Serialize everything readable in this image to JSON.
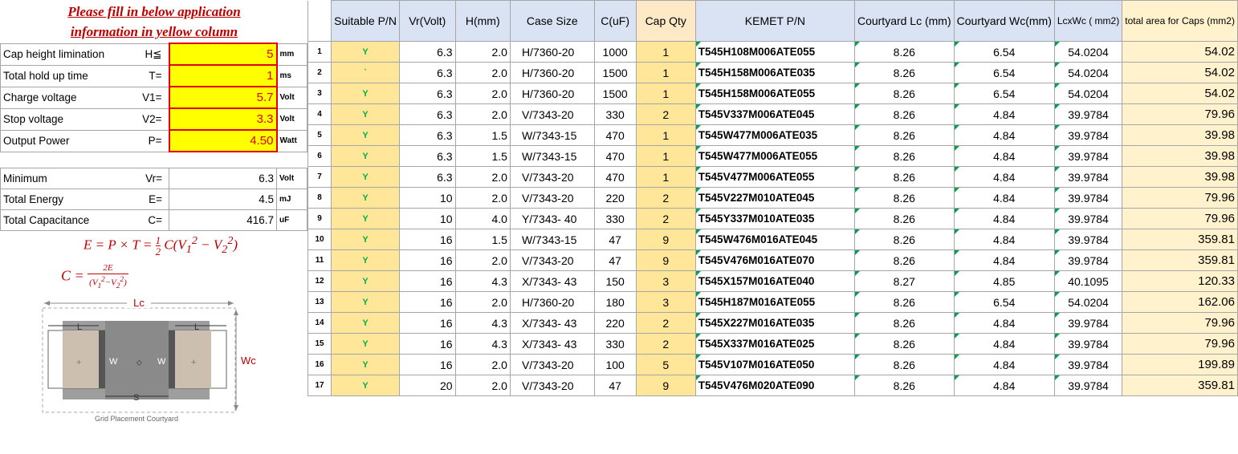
{
  "header": {
    "line1": "Please fill in below application",
    "line2": "information in yellow column"
  },
  "inputs": [
    {
      "label": "Cap height limination",
      "symbol": "H≦",
      "value": "5",
      "unit": "mm"
    },
    {
      "label": "Total hold up time",
      "symbol": "T=",
      "value": "1",
      "unit": "ms"
    },
    {
      "label": "Charge voltage",
      "symbol": "V1=",
      "value": "5.7",
      "unit": "Volt"
    },
    {
      "label": "Stop voltage",
      "symbol": "V2=",
      "value": "3.3",
      "unit": "Volt"
    },
    {
      "label": "Output Power",
      "symbol": "P=",
      "value": "4.50",
      "unit": "Watt"
    }
  ],
  "results": [
    {
      "label": "Minimum",
      "symbol": "Vr=",
      "value": "6.3",
      "unit": "Volt"
    },
    {
      "label": " Total Energy",
      "symbol": "E=",
      "value": "4.5",
      "unit": "mJ"
    },
    {
      "label": "Total Capacitance",
      "symbol": "C=",
      "value": "416.7",
      "unit": "uF"
    }
  ],
  "formulas": {
    "energy": "E = P × T = ½C(V₁² − V₂²)",
    "capacitance": "C = 2E / (V₁² − V₂²)"
  },
  "diagram": {
    "lc_label": "Lc",
    "wc_label": "Wc",
    "l_label": "L",
    "w_label": "W",
    "s_label": "S",
    "caption": "Grid Placement Courtyard"
  },
  "table": {
    "headers": {
      "suitable": "Suitable P/N",
      "vr": "Vr(Volt)",
      "h": "H(mm)",
      "case": "Case Size",
      "c": "C(uF)",
      "qty": "Cap Qty",
      "pn": "KEMET P/N",
      "lc": "Courtyard Lc (mm)",
      "wc": "Courtyard Wc(mm)",
      "lcxwc": "LcxWc ( mm2)",
      "total": "total area for Caps (mm2)"
    },
    "rows": [
      {
        "idx": "1",
        "suit": "Y",
        "vr": "6.3",
        "h": "2.0",
        "case": "H/7360-20",
        "c": "1000",
        "qty": "1",
        "pn": "T545H108M006ATE055",
        "lc": "8.26",
        "wc": "6.54",
        "lcxwc": "54.0204",
        "total": "54.02"
      },
      {
        "idx": "2",
        "suit": "`",
        "vr": "6.3",
        "h": "2.0",
        "case": "H/7360-20",
        "c": "1500",
        "qty": "1",
        "pn": "T545H158M006ATE035",
        "lc": "8.26",
        "wc": "6.54",
        "lcxwc": "54.0204",
        "total": "54.02"
      },
      {
        "idx": "3",
        "suit": "Y",
        "vr": "6.3",
        "h": "2.0",
        "case": "H/7360-20",
        "c": "1500",
        "qty": "1",
        "pn": "T545H158M006ATE055",
        "lc": "8.26",
        "wc": "6.54",
        "lcxwc": "54.0204",
        "total": "54.02"
      },
      {
        "idx": "4",
        "suit": "Y",
        "vr": "6.3",
        "h": "2.0",
        "case": "V/7343-20",
        "c": "330",
        "qty": "2",
        "pn": "T545V337M006ATE045",
        "lc": "8.26",
        "wc": "4.84",
        "lcxwc": "39.9784",
        "total": "79.96"
      },
      {
        "idx": "5",
        "suit": "Y",
        "vr": "6.3",
        "h": "1.5",
        "case": "W/7343-15",
        "c": "470",
        "qty": "1",
        "pn": "T545W477M006ATE035",
        "lc": "8.26",
        "wc": "4.84",
        "lcxwc": "39.9784",
        "total": "39.98"
      },
      {
        "idx": "6",
        "suit": "Y",
        "vr": "6.3",
        "h": "1.5",
        "case": "W/7343-15",
        "c": "470",
        "qty": "1",
        "pn": "T545W477M006ATE055",
        "lc": "8.26",
        "wc": "4.84",
        "lcxwc": "39.9784",
        "total": "39.98"
      },
      {
        "idx": "7",
        "suit": "Y",
        "vr": "6.3",
        "h": "2.0",
        "case": "V/7343-20",
        "c": "470",
        "qty": "1",
        "pn": "T545V477M006ATE055",
        "lc": "8.26",
        "wc": "4.84",
        "lcxwc": "39.9784",
        "total": "39.98"
      },
      {
        "idx": "8",
        "suit": "Y",
        "vr": "10",
        "h": "2.0",
        "case": "V/7343-20",
        "c": "220",
        "qty": "2",
        "pn": "T545V227M010ATE045",
        "lc": "8.26",
        "wc": "4.84",
        "lcxwc": "39.9784",
        "total": "79.96"
      },
      {
        "idx": "9",
        "suit": "Y",
        "vr": "10",
        "h": "4.0",
        "case": "Y/7343- 40",
        "c": "330",
        "qty": "2",
        "pn": "T545Y337M010ATE035",
        "lc": "8.26",
        "wc": "4.84",
        "lcxwc": "39.9784",
        "total": "79.96"
      },
      {
        "idx": "10",
        "suit": "Y",
        "vr": "16",
        "h": "1.5",
        "case": "W/7343-15",
        "c": "47",
        "qty": "9",
        "pn": "T545W476M016ATE045",
        "lc": "8.26",
        "wc": "4.84",
        "lcxwc": "39.9784",
        "total": "359.81"
      },
      {
        "idx": "11",
        "suit": "Y",
        "vr": "16",
        "h": "2.0",
        "case": "V/7343-20",
        "c": "47",
        "qty": "9",
        "pn": "T545V476M016ATE070",
        "lc": "8.26",
        "wc": "4.84",
        "lcxwc": "39.9784",
        "total": "359.81"
      },
      {
        "idx": "12",
        "suit": "Y",
        "vr": "16",
        "h": "4.3",
        "case": "X/7343- 43",
        "c": "150",
        "qty": "3",
        "pn": "T545X157M016ATE040",
        "lc": "8.27",
        "wc": "4.85",
        "lcxwc": "40.1095",
        "total": "120.33"
      },
      {
        "idx": "13",
        "suit": "Y",
        "vr": "16",
        "h": "2.0",
        "case": "H/7360-20",
        "c": "180",
        "qty": "3",
        "pn": "T545H187M016ATE055",
        "lc": "8.26",
        "wc": "6.54",
        "lcxwc": "54.0204",
        "total": "162.06"
      },
      {
        "idx": "14",
        "suit": "Y",
        "vr": "16",
        "h": "4.3",
        "case": "X/7343- 43",
        "c": "220",
        "qty": "2",
        "pn": "T545X227M016ATE035",
        "lc": "8.26",
        "wc": "4.84",
        "lcxwc": "39.9784",
        "total": "79.96"
      },
      {
        "idx": "15",
        "suit": "Y",
        "vr": "16",
        "h": "4.3",
        "case": "X/7343- 43",
        "c": "330",
        "qty": "2",
        "pn": "T545X337M016ATE025",
        "lc": "8.26",
        "wc": "4.84",
        "lcxwc": "39.9784",
        "total": "79.96"
      },
      {
        "idx": "16",
        "suit": "Y",
        "vr": "16",
        "h": "2.0",
        "case": "V/7343-20",
        "c": "100",
        "qty": "5",
        "pn": "T545V107M016ATE050",
        "lc": "8.26",
        "wc": "4.84",
        "lcxwc": "39.9784",
        "total": "199.89"
      },
      {
        "idx": "17",
        "suit": "Y",
        "vr": "20",
        "h": "2.0",
        "case": "V/7343-20",
        "c": "47",
        "qty": "9",
        "pn": "T545V476M020ATE090",
        "lc": "8.26",
        "wc": "4.84",
        "lcxwc": "39.9784",
        "total": "359.81"
      }
    ]
  },
  "colors": {
    "input_fill": "#ffff00",
    "input_border": "#e00000",
    "header_fill": "#dae3f3",
    "suitable_fill": "#ffe699",
    "area_fill": "#fff2cc",
    "title_red": "#c00000",
    "suitable_text": "#00b050"
  }
}
